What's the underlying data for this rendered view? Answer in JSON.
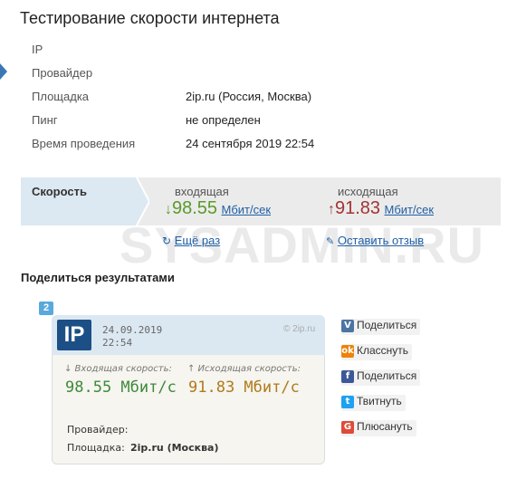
{
  "page": {
    "title": "Тестирование скорости интернета"
  },
  "info": {
    "rows": [
      {
        "label": "IP",
        "value": ""
      },
      {
        "label": "Провайдер",
        "value": ""
      },
      {
        "label": "Площадка",
        "value": "2ip.ru (Россия, Москва)"
      },
      {
        "label": "Пинг",
        "value": "не определен"
      },
      {
        "label": "Время проведения",
        "value": "24 сентября 2019 22:54"
      }
    ]
  },
  "speed": {
    "label": "Скорость",
    "incoming": {
      "label": "входящая",
      "arrow": "↓",
      "value": "98.55",
      "unit": "Мбит/сек"
    },
    "outgoing": {
      "label": "исходящая",
      "arrow": "↑",
      "value": "91.83",
      "unit": "Мбит/сек"
    },
    "retry_label": "Ещё раз",
    "feedback_label": "Оставить отзыв"
  },
  "watermark": "SYSADMIN.RU",
  "share": {
    "title": "Поделиться результатами",
    "badge": "2",
    "buttons": [
      {
        "label": "Поделиться",
        "icon": "vk-icon"
      },
      {
        "label": "Класснуть",
        "icon": "ok-icon"
      },
      {
        "label": "Поделиться",
        "icon": "facebook-icon"
      },
      {
        "label": "Твитнуть",
        "icon": "twitter-icon"
      },
      {
        "label": "Плюсануть",
        "icon": "google-plus-icon"
      }
    ]
  },
  "card": {
    "logo": "IP",
    "date": "24.09.2019",
    "time": "22:54",
    "site": "© 2ip.ru",
    "incoming_label": "↓ Входящая скорость:",
    "outgoing_label": "↑ Исходящая скорость:",
    "incoming_value": "98.55 Мбит/с",
    "outgoing_value": "91.83 Мбит/с",
    "provider_label": "Провайдер:",
    "provider_value": "",
    "site_label": "Площадка:",
    "site_value": "2ip.ru (Москва)"
  },
  "colors": {
    "accent": "#1f5fa6",
    "incoming": "#5a9a2a",
    "outgoing": "#a33333",
    "card_incoming": "#3d8a3d",
    "card_outgoing": "#b07a1e",
    "vk": "#4c75a3",
    "ok": "#ee8208",
    "facebook": "#3b5998",
    "twitter": "#1da1f2",
    "google_plus": "#dd4b39"
  }
}
